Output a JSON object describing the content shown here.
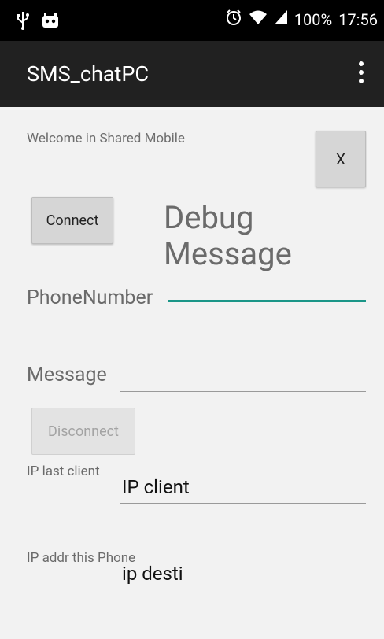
{
  "status_bar": {
    "usb_icon": "usb-icon",
    "notification_icon": "android-icon",
    "alarm_icon": "alarm-icon",
    "wifi_icon": "wifi-icon",
    "signal_icon": "signal-icon",
    "battery": "100%",
    "time": "17:56"
  },
  "action_bar": {
    "title": "SMS_chatPC",
    "overflow_icon": "more-vert-icon"
  },
  "main": {
    "welcome_text": "Welcome in Shared Mobile",
    "close_button": "X",
    "connect_button": "Connect",
    "debug_line1": "Debug",
    "debug_line2": "Message",
    "phone_label": "PhoneNumber",
    "phone_value": "",
    "message_label": "Message",
    "message_value": "",
    "disconnect_button": "Disconnect",
    "ip_last_label": "IP last client",
    "ip_client_value": "IP client",
    "ip_addr_label": "IP addr this Phone",
    "ip_desti_value": "ip desti"
  },
  "colors": {
    "status_bar": "#000000",
    "action_bar": "#212121",
    "accent": "#1b9688",
    "background": "#f2f2f2"
  }
}
